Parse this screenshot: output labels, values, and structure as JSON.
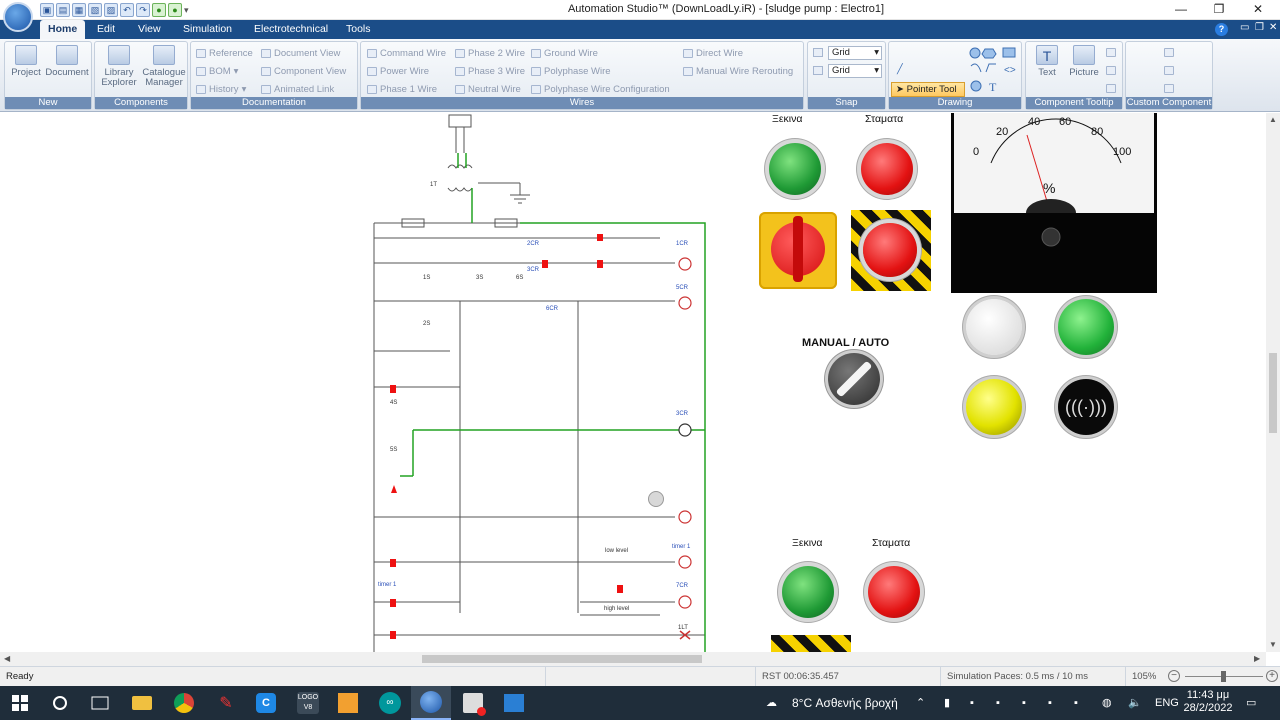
{
  "window": {
    "title": "Automation Studio™ (DownLoadLy.iR) - [sludge pump : Electro1]"
  },
  "tabs": [
    "Home",
    "Edit",
    "View",
    "Simulation",
    "Electrotechnical",
    "Tools"
  ],
  "ribbon": {
    "groups": {
      "new": "New",
      "components": "Components",
      "documentation": "Documentation",
      "wires": "Wires",
      "snap": "Snap",
      "drawing": "Drawing",
      "tooltip": "Component Tooltip",
      "custom": "Custom Component"
    },
    "project": "Project",
    "document": "Document",
    "library": "Library\nExplorer",
    "catalogue": "Catalogue\nManager",
    "doc": {
      "reference": "Reference",
      "bom": "BOM",
      "history": "History",
      "document_view": "Document View",
      "component_view": "Component View",
      "animated_link": "Animated Link"
    },
    "wires": {
      "command": "Command Wire",
      "power": "Power Wire",
      "phase1": "Phase 1 Wire",
      "phase2": "Phase 2 Wire",
      "phase3": "Phase 3 Wire",
      "neutral": "Neutral Wire",
      "ground": "Ground Wire",
      "polyphase": "Polyphase Wire",
      "polyphase_cfg": "Polyphase Wire Configuration",
      "direct": "Direct Wire",
      "manual": "Manual Wire Rerouting"
    },
    "snap": {
      "grid1": "Grid",
      "grid2": "Grid"
    },
    "drawing": {
      "pointer": "Pointer Tool",
      "text": "Text",
      "picture": "Picture"
    }
  },
  "panel": {
    "start_top": "Ξεκινα",
    "stop_top": "Σταματα",
    "manual_auto": "MANUAL  /  AUTO",
    "start_bottom": "Ξεκινα",
    "stop_bottom": "Σταματα",
    "gauge_unit": "%",
    "gauge_ticks": [
      "0",
      "20",
      "40",
      "60",
      "80",
      "100"
    ]
  },
  "schematic": {
    "labels": [
      "1CR",
      "2CR",
      "3CR",
      "5CR",
      "6CR",
      "7CR",
      "1S",
      "2S",
      "3S",
      "4S",
      "5S",
      "6S",
      "1T",
      "3CR",
      "timer 1",
      "low level",
      "high level",
      "timer 1",
      "1LT"
    ]
  },
  "status": {
    "ready": "Ready",
    "rst": "RST 00:06:35.457",
    "sim_pace": "Simulation Paces: 0.5 ms / 10 ms",
    "zoom": "105%"
  },
  "taskbar": {
    "weather": "8°C  Ασθενής βροχή",
    "lang": "ENG",
    "time": "11:43 μμ",
    "date": "28/2/2022"
  }
}
